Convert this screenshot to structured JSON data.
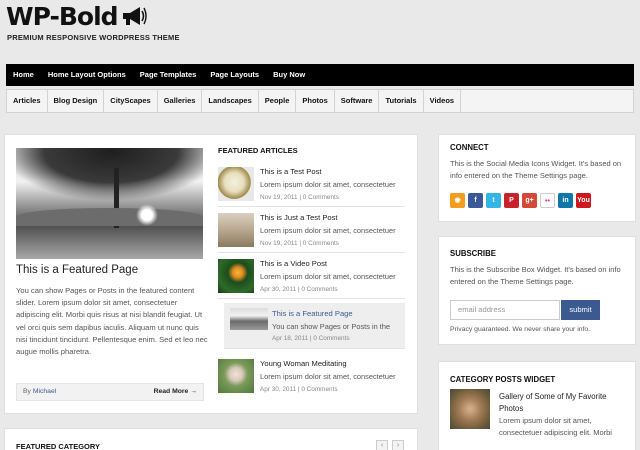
{
  "header": {
    "logo": "WP-Bold",
    "tagline": "PREMIUM RESPONSIVE WORDPRESS THEME",
    "logo_icon": "megaphone-icon"
  },
  "nav_primary": [
    "Home",
    "Home Layout Options",
    "Page Templates",
    "Page Layouts",
    "Buy Now"
  ],
  "nav_secondary": [
    "Articles",
    "Blog Design",
    "CityScapes",
    "Galleries",
    "Landscapes",
    "People",
    "Photos",
    "Software",
    "Tutorials",
    "Videos"
  ],
  "featured_page": {
    "title": "This is a Featured Page",
    "text": "You can show Pages or Posts in the featured content slider. Lorem ipsum dolor sit amet, consectetuer adipiscing elit. Morbi quis risus at nisi blandit feugiat. Ut vel orci quis sem dapibus iaculis. Aliquam ut nunc quis nisi tincidunt tincidunt. Pellentesque enim. Sed et leo nec augue mollis pharetra.",
    "by_label": "By",
    "author": "Michael",
    "read_more": "Read More →"
  },
  "featured_articles": {
    "heading": "FEATURED ARTICLES",
    "items": [
      {
        "title": "This is a Test Post",
        "excerpt": "Lorem ipsum dolor sit amet, consectetuer",
        "date": "Nov 19, 2011",
        "comments": "0 Comments"
      },
      {
        "title": "This is Just a Test Post",
        "excerpt": "Lorem ipsum dolor sit amet, consectetuer",
        "date": "Nov 19, 2011",
        "comments": "0 Comments"
      },
      {
        "title": "This is a Video Post",
        "excerpt": "Lorem ipsum dolor sit amet, consectetuer",
        "date": "Apr 30, 2011",
        "comments": "0 Comments"
      },
      {
        "title": "This is a Featured Page",
        "excerpt": "You can show Pages or Posts in the",
        "date": "Apr 18, 2011",
        "comments": "0 Comments"
      },
      {
        "title": "Young Woman Meditating",
        "excerpt": "Lorem ipsum dolor sit amet, consectetuer",
        "date": "Apr 30, 2011",
        "comments": "0 Comments"
      }
    ]
  },
  "featured_category": {
    "heading": "FEATURED CATEGORY",
    "prev": "‹",
    "next": "›"
  },
  "connect": {
    "heading": "CONNECT",
    "text": "This is the Social Media Icons Widget. It's based on info entered on the Theme Settings page.",
    "icons": [
      {
        "name": "rss-icon",
        "glyph": "◉",
        "color": "#f39c1e"
      },
      {
        "name": "facebook-icon",
        "glyph": "f",
        "color": "#3b5998"
      },
      {
        "name": "twitter-icon",
        "glyph": "t",
        "color": "#33b5e5"
      },
      {
        "name": "pinterest-icon",
        "glyph": "P",
        "color": "#c8232c"
      },
      {
        "name": "google-plus-icon",
        "glyph": "g+",
        "color": "#d34836"
      },
      {
        "name": "flickr-icon",
        "glyph": "••",
        "color": "#ffffff"
      },
      {
        "name": "linkedin-icon",
        "glyph": "in",
        "color": "#0e76a8"
      },
      {
        "name": "youtube-icon",
        "glyph": "You",
        "color": "#cc181e"
      }
    ]
  },
  "subscribe": {
    "heading": "SUBSCRIBE",
    "text": "This is the Subscribe Box Widget. It's based on info entered on the Theme Settings page.",
    "placeholder": "email address",
    "button": "submit",
    "note": "Privacy guaranteed. We never share your info."
  },
  "category_posts": {
    "heading": "CATEGORY POSTS WIDGET",
    "item_title": "Gallery of Some of My Favorite Photos",
    "item_text": "Lorem ipsum dolor sit amet, consectetuer adipiscing elit. Morbi"
  }
}
